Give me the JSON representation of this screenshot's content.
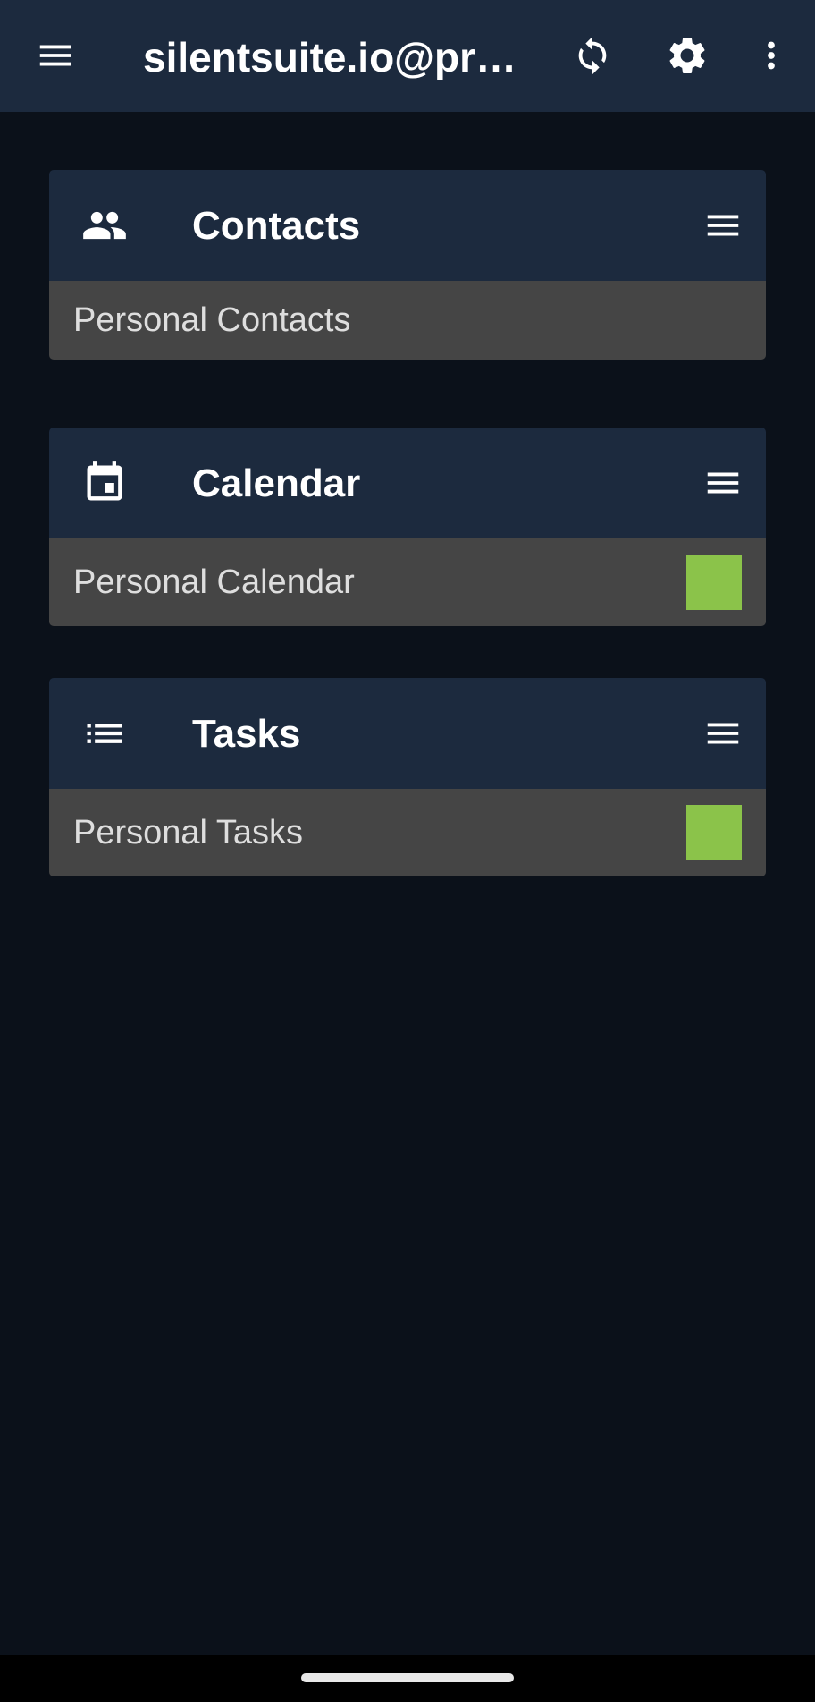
{
  "app_bar": {
    "title": "silentsuite.io@prot…",
    "icons": [
      "menu-icon",
      "sync-icon",
      "settings-icon",
      "more-vert-icon"
    ]
  },
  "sections": {
    "contacts": {
      "title": "Contacts",
      "icon": "contacts-icon",
      "items": [
        {
          "label": "Personal Contacts"
        }
      ]
    },
    "calendar": {
      "title": "Calendar",
      "icon": "calendar-icon",
      "items": [
        {
          "label": "Personal Calendar",
          "color": "#8bc34a"
        }
      ]
    },
    "tasks": {
      "title": "Tasks",
      "icon": "task-list-icon",
      "items": [
        {
          "label": "Personal Tasks",
          "color": "#8bc34a"
        }
      ]
    }
  },
  "colors": {
    "background": "#0b111a",
    "app_bar": "#1c2a3e",
    "row_background": "#454545",
    "swatch": "#8bc34a"
  }
}
